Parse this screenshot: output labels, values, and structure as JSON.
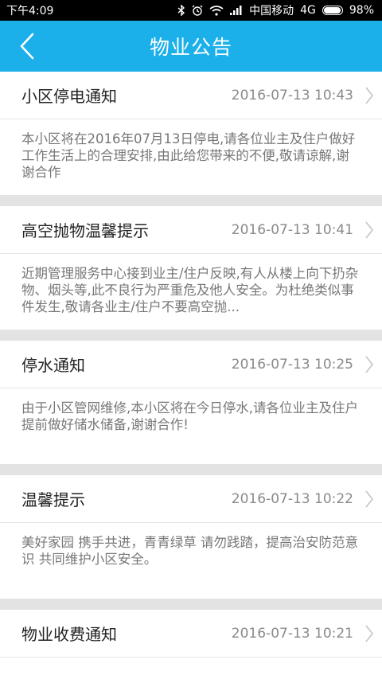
{
  "status_bar": {
    "time": "下午4:09",
    "carrier": "中国移动",
    "network": "4G",
    "battery": "98%"
  },
  "header": {
    "title": "物业公告"
  },
  "notices": [
    {
      "title": "小区停电通知",
      "date": "2016-07-13 10:43",
      "body": "本小区将在2016年07月13日停电,请各位业主及住户做好工作生活上的合理安排,由此给您带来的不便,敬请谅解,谢谢合作"
    },
    {
      "title": "高空抛物温馨提示",
      "date": "2016-07-13 10:41",
      "body": "近期管理服务中心接到业主/住户反映,有人从楼上向下扔杂物、烟头等,此不良行为严重危及他人安全。为杜绝类似事件发生,敬请各业主/住户不要高空抛..."
    },
    {
      "title": "停水通知",
      "date": "2016-07-13 10:25",
      "body": "由于小区管网维修,本小区将在今日停水,请各位业主及住户提前做好储水储备,谢谢合作!"
    },
    {
      "title": "温馨提示",
      "date": "2016-07-13 10:22",
      "body": "美好家园 携手共进，青青绿草 请勿践踏，提高治安防范意识 共同维护小区安全。"
    },
    {
      "title": "物业收费通知",
      "date": "2016-07-13 10:21",
      "body": ""
    }
  ]
}
